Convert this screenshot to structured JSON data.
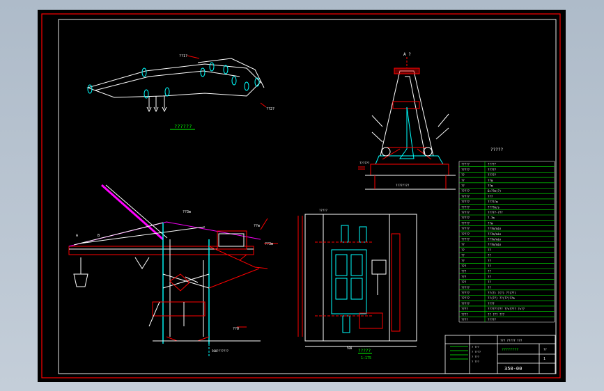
{
  "app": {
    "accent": "#ff0000",
    "line_color": "#00ffff",
    "white": "#ffffff",
    "green": "#00ff00"
  },
  "views": {
    "boom_caption": "??????",
    "sideview_caption": "?????",
    "sideview_sub": "1:175",
    "endview_label": "A ?",
    "table_title": "?????"
  },
  "annotations": {
    "boom_tag1": "??1?",
    "boom_tag2": "??2?",
    "crane_tag_top": "??3m",
    "crane_tag_right": "??m",
    "crane_tag_far": "??3m",
    "crane_A": "A",
    "crane_B": "B",
    "dim_bottom": "??0",
    "scale_bottom": "500???????",
    "mech_dim_top": "?????",
    "mech_dim_bottom": "500",
    "end_dim": "????????",
    "end_left": "??????"
  },
  "spec_table": {
    "rows": [
      [
        "?????",
        "?????"
      ],
      [
        "?????",
        "?????"
      ],
      [
        "??",
        "?????"
      ],
      [
        "??",
        "??m"
      ],
      [
        "??",
        "??m"
      ],
      [
        "?????",
        "6×??m(?)"
      ],
      [
        "?????",
        "???"
      ],
      [
        "?????",
        "????/m"
      ],
      [
        "?????",
        "????m/s"
      ],
      [
        "?????",
        "?????-???"
      ],
      [
        "?????",
        "?.?m"
      ],
      [
        "?????",
        "??m"
      ],
      [
        "?????",
        "???m/min"
      ],
      [
        "?????",
        "???m/min"
      ],
      [
        "?????",
        "???m/min"
      ],
      [
        "??",
        "???m/min"
      ],
      [
        "??",
        "??"
      ],
      [
        "??",
        "??"
      ],
      [
        "??",
        "??"
      ],
      [
        "???",
        "??"
      ],
      [
        "???",
        "??"
      ],
      [
        "???",
        "??"
      ],
      [
        "???",
        "??"
      ],
      [
        "?????",
        "??"
      ],
      [
        "?????",
        "??(?) ?(?) ??(??)"
      ],
      [
        "?????",
        "??(??)  ??(??)??m"
      ],
      [
        "?????",
        "????"
      ],
      [
        "????",
        "?????????  ??×????  ?×??"
      ],
      [
        "????",
        "??   ???   ???"
      ],
      [
        "????",
        "?????"
      ]
    ]
  },
  "title_block": {
    "school": "??? ????? ???",
    "drawing_name": "????????",
    "drawing_no": "350-00",
    "sheet": "1",
    "scale": "??",
    "notes": [
      "? ???",
      "? ????",
      "? ???",
      "? ???"
    ]
  }
}
